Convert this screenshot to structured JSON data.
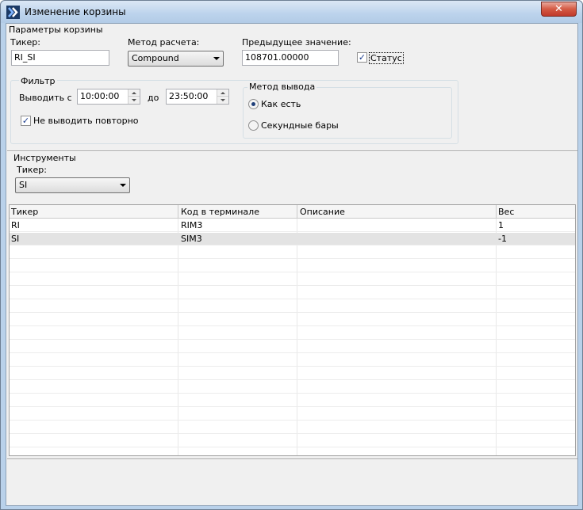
{
  "window": {
    "title": "Изменение корзины",
    "close_glyph": "✕"
  },
  "params": {
    "group_label": "Параметры корзины",
    "ticker_label": "Тикер:",
    "ticker_value": "RI_SI",
    "method_label": "Метод расчета:",
    "method_value": "Compound",
    "prev_label": "Предыдущее значение:",
    "prev_value": "108701.00000",
    "status_label": "Статус",
    "status_checked": true
  },
  "filter": {
    "group_label": "Фильтр",
    "from_label": "Выводить с",
    "from_value": "10:00:00",
    "to_label": "до",
    "to_value": "23:50:00",
    "no_repeat_label": "Не выводить повторно",
    "no_repeat_checked": true
  },
  "output": {
    "group_label": "Метод вывода",
    "options": [
      {
        "label": "Как есть",
        "selected": true
      },
      {
        "label": "Секундные бары",
        "selected": false
      }
    ]
  },
  "instruments": {
    "group_label": "Инструменты",
    "ticker_label": "Тикер:",
    "ticker_value": "SI",
    "columns": [
      "Тикер",
      "Код в терминале",
      "Описание",
      "Вес"
    ],
    "rows": [
      [
        "RI",
        "RIM3",
        "",
        "1"
      ],
      [
        "SI",
        "SIM3",
        "",
        "-1"
      ]
    ]
  }
}
